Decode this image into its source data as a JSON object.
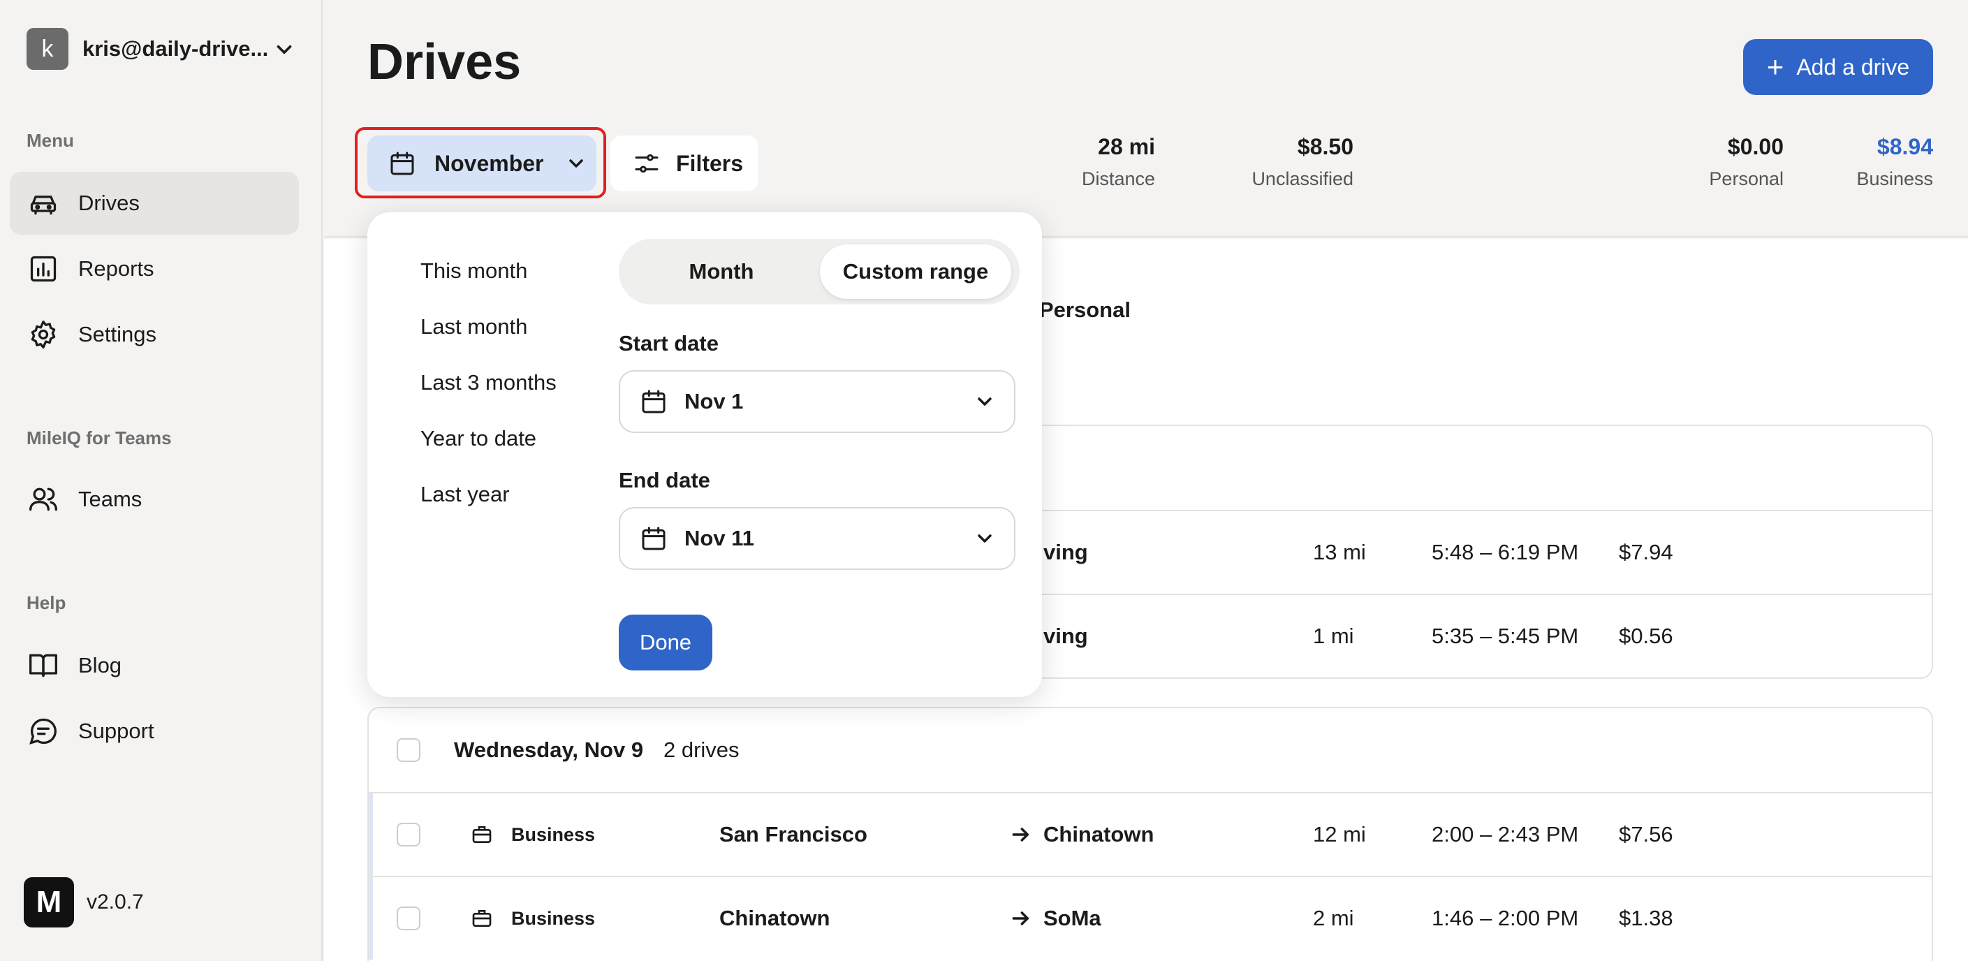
{
  "account": {
    "initial": "k",
    "email": "kris@daily-drive..."
  },
  "sidebar": {
    "menu_label": "Menu",
    "items": [
      {
        "label": "Drives",
        "icon": "car-icon",
        "active": true
      },
      {
        "label": "Reports",
        "icon": "chart-icon"
      },
      {
        "label": "Settings",
        "icon": "gear-icon"
      }
    ],
    "teams_label": "MileIQ for Teams",
    "teams_items": [
      {
        "label": "Teams",
        "icon": "people-icon"
      }
    ],
    "help_label": "Help",
    "help_items": [
      {
        "label": "Blog",
        "icon": "book-icon"
      },
      {
        "label": "Support",
        "icon": "chat-icon"
      }
    ],
    "logo_glyph": "M",
    "version": "v2.0.7"
  },
  "header": {
    "title": "Drives",
    "add_button": "Add a drive",
    "month_button": "November",
    "filters_button": "Filters",
    "stats": [
      {
        "value": "28 mi",
        "label": "Distance"
      },
      {
        "value": "$8.50",
        "label": "Unclassified"
      },
      {
        "value": "$0.00",
        "label": "Personal"
      },
      {
        "value": "$8.94",
        "label": "Business"
      }
    ],
    "accent_color": "#2f65c9"
  },
  "popover": {
    "quick_ranges": [
      "This month",
      "Last month",
      "Last 3 months",
      "Year to date",
      "Last year"
    ],
    "mode_options": [
      "Month",
      "Custom range"
    ],
    "selected_mode": "Custom range",
    "start_label": "Start date",
    "start_value": "Nov 1",
    "end_label": "End date",
    "end_value": "Nov 11",
    "done_button": "Done"
  },
  "partial_text": {
    "personal_tab": "Personal",
    "row1_dest_fragment": "ving",
    "row2_dest_fragment": "ving"
  },
  "drives_group1": [
    {
      "distance": "13 mi",
      "time": "5:48 – 6:19 PM",
      "value": "$7.94"
    },
    {
      "distance": "1 mi",
      "time": "5:35 – 5:45 PM",
      "value": "$0.56"
    }
  ],
  "drives_group2": {
    "date": "Wednesday, Nov 9",
    "count": "2 drives",
    "drives": [
      {
        "type": "Business",
        "from": "San Francisco",
        "to": "Chinatown",
        "distance": "12 mi",
        "time": "2:00 – 2:43 PM",
        "value": "$7.56"
      },
      {
        "type": "Business",
        "from": "Chinatown",
        "to": "SoMa",
        "distance": "2 mi",
        "time": "1:46 – 2:00 PM",
        "value": "$1.38"
      }
    ]
  }
}
